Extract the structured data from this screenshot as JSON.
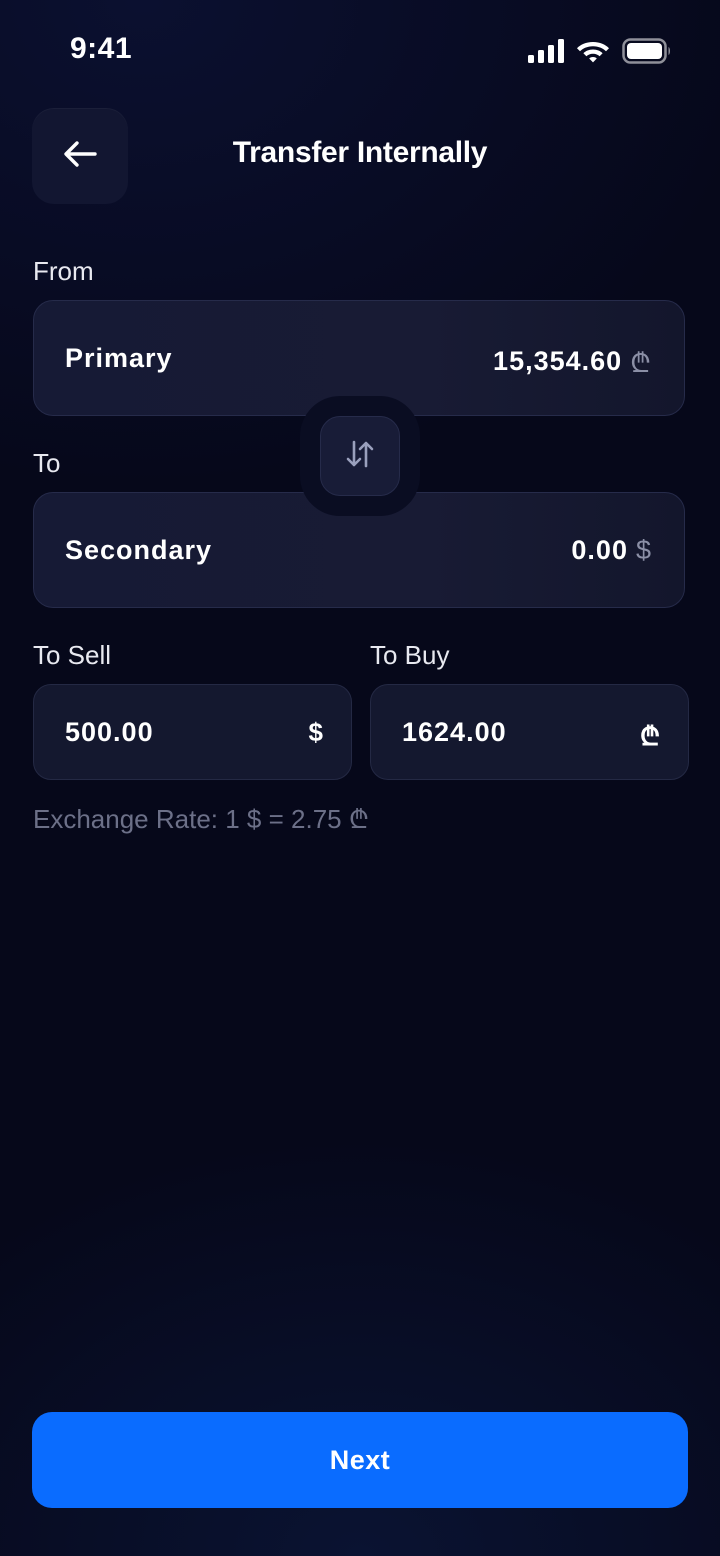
{
  "status_bar": {
    "time": "9:41",
    "icons": [
      "signal-icon",
      "wifi-icon",
      "battery-icon"
    ]
  },
  "header": {
    "title": "Transfer Internally",
    "back_icon": "arrow-left-icon"
  },
  "from": {
    "label": "From",
    "account_name": "Primary",
    "balance": "15,354.60",
    "currency_symbol": "₾"
  },
  "swap": {
    "icon": "swap-vertical-icon"
  },
  "to": {
    "label": "To",
    "account_name": "Secondary",
    "balance": "0.00",
    "currency_symbol": "$"
  },
  "sell": {
    "label": "To Sell",
    "value": "500.00",
    "currency_symbol": "$"
  },
  "buy": {
    "label": "To Buy",
    "value": "1624.00",
    "currency_symbol": "₾"
  },
  "exchange_rate": "Exchange Rate: 1 $ = 2.75 ₾",
  "next_button": {
    "label": "Next"
  },
  "colors": {
    "background": "#06081a",
    "card": "#161a35",
    "accent": "#0a6cff",
    "muted_text": "#6c7088"
  }
}
